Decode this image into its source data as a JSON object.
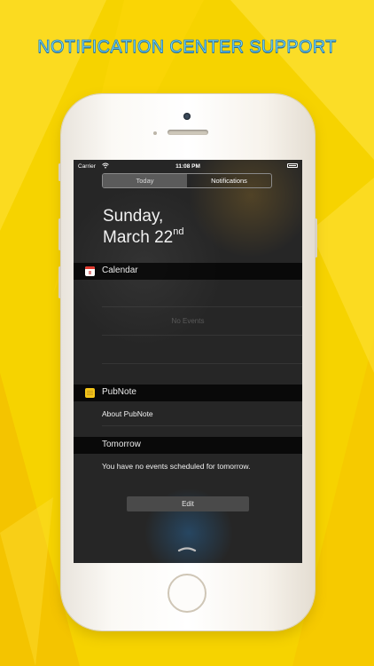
{
  "banner": {
    "title": "NOTIFICATION CENTER SUPPORT"
  },
  "status_bar": {
    "carrier": "Carrier",
    "time": "11:08 PM",
    "wifi_icon": "wifi-icon",
    "battery_icon": "battery-icon"
  },
  "tabs": [
    {
      "label": "Today",
      "selected": true
    },
    {
      "label": "Notifications",
      "selected": false
    }
  ],
  "date": {
    "line1": "Sunday,",
    "line2": "March 22",
    "suffix": "nd"
  },
  "calendar_widget": {
    "title": "Calendar",
    "icon": "calendar-icon",
    "empty_text": "No Events"
  },
  "pubnote_widget": {
    "title": "PubNote",
    "icon": "note-icon",
    "link_text": "About PubNote"
  },
  "tomorrow_widget": {
    "title": "Tomorrow",
    "message": "You have no events scheduled for tomorrow."
  },
  "footer": {
    "edit_label": "Edit",
    "grabber_icon": "chevron-grabber-icon"
  },
  "colors": {
    "background": "#f6d300",
    "banner_text": "#7ad9f2",
    "screen": "#262626",
    "phone_body": "#fbf9f5"
  }
}
